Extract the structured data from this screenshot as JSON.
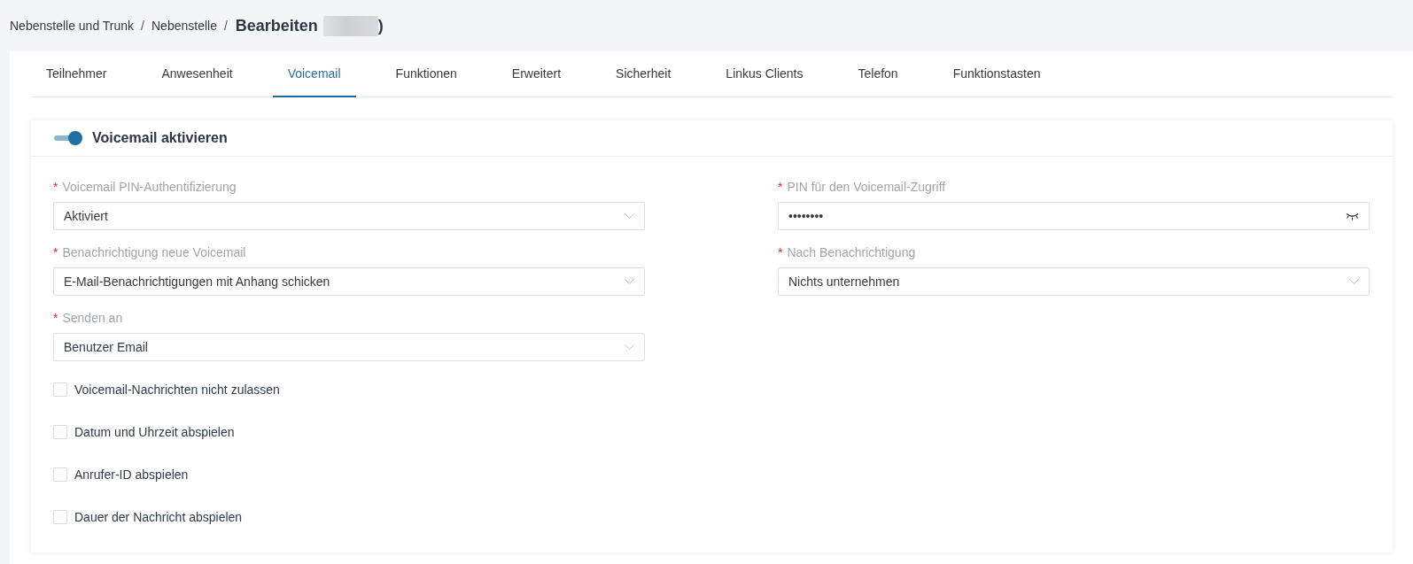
{
  "breadcrumb": {
    "items": [
      {
        "label": "Nebenstelle und Trunk",
        "separator": "/"
      },
      {
        "label": "Nebenstelle",
        "separator": "/"
      }
    ],
    "title": "Bearbeiten",
    "title_suffix": ")"
  },
  "tabs": [
    {
      "label": "Teilnehmer",
      "selected": false
    },
    {
      "label": "Anwesenheit",
      "selected": false
    },
    {
      "label": "Voicemail",
      "selected": true
    },
    {
      "label": "Funktionen",
      "selected": false
    },
    {
      "label": "Erweitert",
      "selected": false
    },
    {
      "label": "Sicherheit",
      "selected": false
    },
    {
      "label": "Linkus Clients",
      "selected": false
    },
    {
      "label": "Telefon",
      "selected": false
    },
    {
      "label": "Funktionstasten",
      "selected": false
    }
  ],
  "section": {
    "title": "Voicemail aktivieren",
    "enabled": true
  },
  "fields": [
    {
      "kind": "select",
      "required_mark": "*",
      "label": "Voicemail PIN-Authentifizierung",
      "value": "Aktiviert"
    },
    {
      "kind": "password",
      "required_mark": "*",
      "label": "PIN für den Voicemail-Zugriff",
      "value": "••••••••"
    },
    {
      "kind": "select",
      "required_mark": "*",
      "label": "Benachrichtigung neue Voicemail",
      "value": "E-Mail-Benachrichtigungen mit Anhang schicken"
    },
    {
      "kind": "select",
      "required_mark": "*",
      "label": "Nach Benachrichtigung",
      "value": "Nichts unternehmen"
    },
    {
      "kind": "select",
      "required_mark": "*",
      "label": "Senden an",
      "value": "Benutzer Email"
    }
  ],
  "checkboxes": [
    {
      "label": "Voicemail-Nachrichten nicht zulassen",
      "checked": false
    },
    {
      "label": "Datum und Uhrzeit abspielen",
      "checked": false
    },
    {
      "label": "Anrufer-ID abspielen",
      "checked": false
    },
    {
      "label": "Dauer der Nachricht abspielen",
      "checked": false
    }
  ]
}
